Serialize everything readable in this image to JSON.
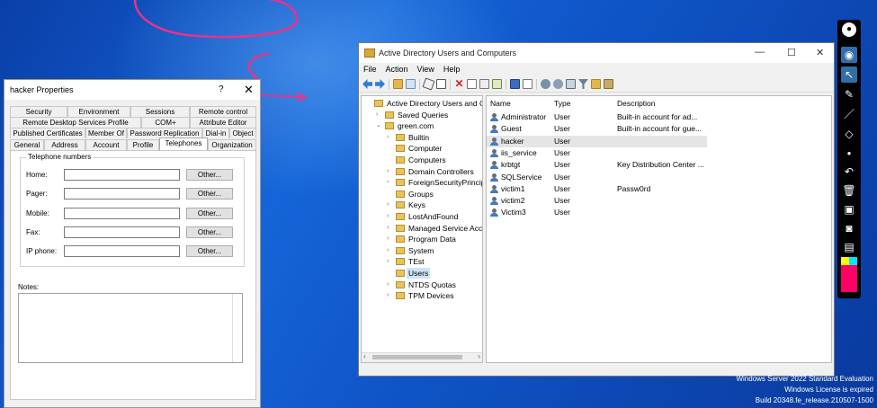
{
  "properties_dialog": {
    "title": "hacker Properties",
    "help_glyph": "?",
    "close_glyph": "✕",
    "tab_rows": [
      [
        "Security",
        "Environment",
        "Sessions",
        "Remote control"
      ],
      [
        "Remote Desktop Services Profile",
        "COM+",
        "Attribute Editor"
      ],
      [
        "Published Certificates",
        "Member Of",
        "Password Replication",
        "Dial-in",
        "Object"
      ],
      [
        "General",
        "Address",
        "Account",
        "Profile",
        "Telephones",
        "Organization"
      ]
    ],
    "active_tab": "Telephones",
    "group_label": "Telephone numbers",
    "fields": [
      {
        "label": "Home:",
        "value": "",
        "button": "Other..."
      },
      {
        "label": "Pager:",
        "value": "",
        "button": "Other..."
      },
      {
        "label": "Mobile:",
        "value": "",
        "button": "Other..."
      },
      {
        "label": "Fax:",
        "value": "",
        "button": "Other..."
      },
      {
        "label": "IP phone:",
        "value": "",
        "button": "Other..."
      }
    ],
    "notes_label": "Notes:",
    "notes_value": ""
  },
  "aduc": {
    "title": "Active Directory Users and Computers",
    "window_controls": {
      "minimize": "—",
      "maximize": "☐",
      "close": "✕"
    },
    "menu": [
      "File",
      "Action",
      "View",
      "Help"
    ],
    "tree": [
      {
        "label": "Active Directory Users and Com",
        "level": 0,
        "expander": "",
        "selected": false
      },
      {
        "label": "Saved Queries",
        "level": 1,
        "expander": "›",
        "selected": false
      },
      {
        "label": "green.com",
        "level": 1,
        "expander": "⌄",
        "selected": false
      },
      {
        "label": "Builtin",
        "level": 2,
        "expander": "›",
        "selected": false
      },
      {
        "label": "Computer",
        "level": 2,
        "expander": "",
        "selected": false
      },
      {
        "label": "Computers",
        "level": 2,
        "expander": "",
        "selected": false
      },
      {
        "label": "Domain Controllers",
        "level": 2,
        "expander": "›",
        "selected": false
      },
      {
        "label": "ForeignSecurityPrincipals",
        "level": 2,
        "expander": "›",
        "selected": false
      },
      {
        "label": "Groups",
        "level": 2,
        "expander": "",
        "selected": false
      },
      {
        "label": "Keys",
        "level": 2,
        "expander": "›",
        "selected": false
      },
      {
        "label": "LostAndFound",
        "level": 2,
        "expander": "›",
        "selected": false
      },
      {
        "label": "Managed Service Accour",
        "level": 2,
        "expander": "›",
        "selected": false
      },
      {
        "label": "Program Data",
        "level": 2,
        "expander": "›",
        "selected": false
      },
      {
        "label": "System",
        "level": 2,
        "expander": "›",
        "selected": false
      },
      {
        "label": "TEst",
        "level": 2,
        "expander": "›",
        "selected": false
      },
      {
        "label": "Users",
        "level": 2,
        "expander": "",
        "selected": true
      },
      {
        "label": "NTDS Quotas",
        "level": 2,
        "expander": "›",
        "selected": false
      },
      {
        "label": "TPM Devices",
        "level": 2,
        "expander": "›",
        "selected": false
      }
    ],
    "columns": [
      "Name",
      "Type",
      "Description"
    ],
    "rows": [
      {
        "name": "Administrator",
        "type": "User",
        "description": "Built-in account for ad...",
        "selected": false
      },
      {
        "name": "Guest",
        "type": "User",
        "description": "Built-in account for gue...",
        "selected": false
      },
      {
        "name": "hacker",
        "type": "User",
        "description": "",
        "selected": true
      },
      {
        "name": "iis_service",
        "type": "User",
        "description": "",
        "selected": false
      },
      {
        "name": "krbtgt",
        "type": "User",
        "description": "Key Distribution Center ...",
        "selected": false
      },
      {
        "name": "SQLService",
        "type": "User",
        "description": "",
        "selected": false
      },
      {
        "name": "victim1",
        "type": "User",
        "description": "Passw0rd",
        "selected": false
      },
      {
        "name": "victim2",
        "type": "User",
        "description": "",
        "selected": false
      },
      {
        "name": "Victim3",
        "type": "User",
        "description": "",
        "selected": false
      }
    ],
    "scroll_left": "‹",
    "scroll_right": "›"
  },
  "pen_toolbar": {
    "colors": [
      "#ffff00",
      "#00e5ff",
      "#ff0066",
      "#ffffff",
      "#000000"
    ]
  },
  "watermark": {
    "line1": "Windows Server 2022 Standard Evaluation",
    "line2": "Windows License is expired",
    "line3": "Build 20348.fe_release.210507-1500"
  },
  "colors": {
    "annotation_pen": "#e8338a",
    "selection": "#cce4f7"
  }
}
